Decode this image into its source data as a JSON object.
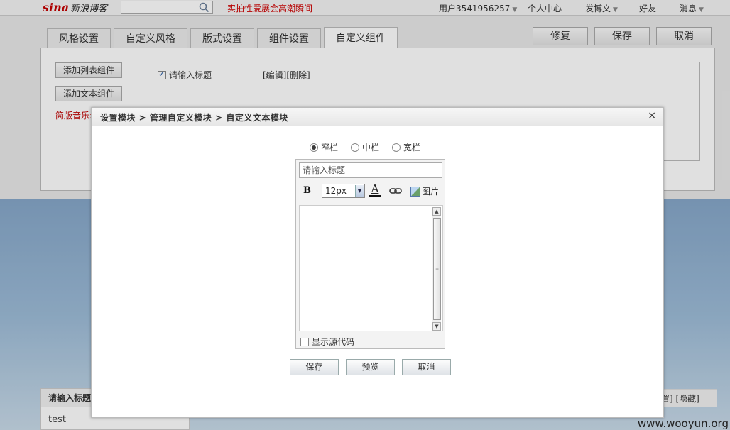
{
  "topbar": {
    "logo_mark": "sina",
    "logo_brand": "新浪博客",
    "search_placeholder": "",
    "hot_link": "实拍性爱展会高潮瞬间",
    "user": "用户3541956257",
    "personal_center": "个人中心",
    "post": "发博文",
    "friends": "好友",
    "messages": "消息"
  },
  "tabs": [
    {
      "label": "风格设置"
    },
    {
      "label": "自定义风格"
    },
    {
      "label": "版式设置"
    },
    {
      "label": "组件设置"
    },
    {
      "label": "自定义组件"
    }
  ],
  "actions": {
    "restore": "修复",
    "save": "保存",
    "cancel": "取消"
  },
  "panel": {
    "add_list": "添加列表组件",
    "add_text": "添加文本组件",
    "music": "简版音乐:",
    "component_title": "请输入标题",
    "component_actions": "[编辑][删除]"
  },
  "dialog": {
    "breadcrumb": "设置模块 > 管理自定义模块 > 自定义文本模块",
    "close": "×",
    "radios": [
      {
        "label": "窄栏",
        "selected": true
      },
      {
        "label": "中栏",
        "selected": false
      },
      {
        "label": "宽栏",
        "selected": false
      }
    ],
    "title_value": "请输入标题",
    "bold": "B",
    "font_size": "12px",
    "color_letter": "A",
    "image_label": "图片",
    "show_source": "显示源代码",
    "save": "保存",
    "preview": "预览",
    "cancel": "取消"
  },
  "background": {
    "card_title": "请输入标题",
    "card_body": "test",
    "right_actions": "置] [隐藏]"
  },
  "watermark": "www.wooyun.org",
  "colors": {
    "brand_red": "#c40000",
    "sky": "#86a7c9"
  }
}
